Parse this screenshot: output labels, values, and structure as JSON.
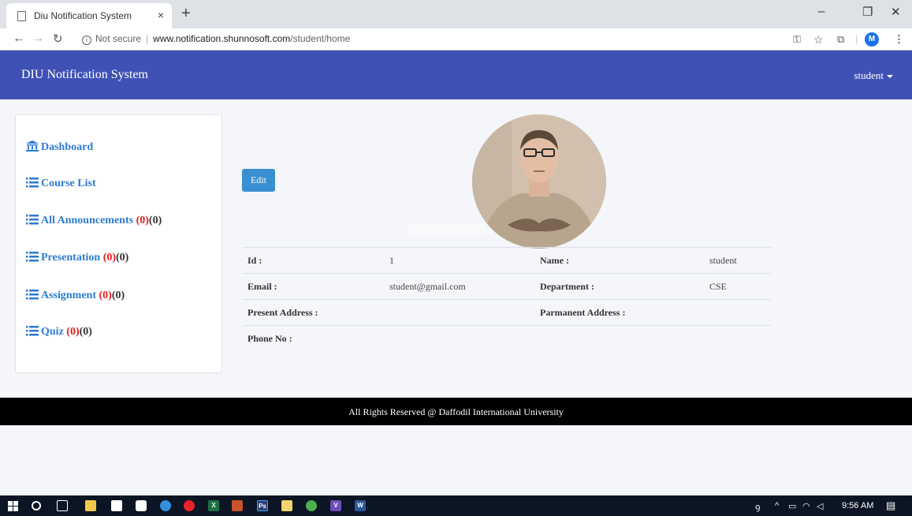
{
  "browser": {
    "tab_title": "Diu Notification System",
    "tab_close": "×",
    "new_tab": "+",
    "security_label": "Not secure",
    "url_host": "www.notification.shunnosoft.com",
    "url_path": "/student/home",
    "profile_initial": "M",
    "window_minimize": "–",
    "window_restore": "❐",
    "window_close": "✕"
  },
  "app": {
    "brand": "DIU Notification System",
    "user_menu": "student"
  },
  "sidebar": {
    "items": [
      {
        "label": "Dashboard",
        "icon": "bank-icon"
      },
      {
        "label": "Course List",
        "icon": "list-icon"
      },
      {
        "label": "All Announcements ",
        "count_new": "(0)",
        "count_total": "(0)",
        "icon": "list-icon"
      },
      {
        "label": "Presentation ",
        "count_new": "(0)",
        "count_total": "(0)",
        "icon": "list-icon"
      },
      {
        "label": "Assignment ",
        "count_new": "(0)",
        "count_total": "(0)",
        "icon": "list-icon"
      },
      {
        "label": "Quiz ",
        "count_new": "(0)",
        "count_total": "(0)",
        "icon": "list-icon"
      }
    ]
  },
  "profile": {
    "edit_label": "Edit",
    "rows": [
      {
        "l1": "Id :",
        "v1": "1",
        "l2": "Name :",
        "v2": "student"
      },
      {
        "l1": "Email :",
        "v1": "student@gmail.com",
        "l2": "Department :",
        "v2": "CSE"
      },
      {
        "l1": "Present Address :",
        "v1": "",
        "l2": "Parmanent Address :",
        "v2": ""
      },
      {
        "l1": "Phone No :",
        "v1": "",
        "l2": "",
        "v2": ""
      }
    ]
  },
  "footer": {
    "text": "All Rights Reserved @ Daffodil International University"
  },
  "taskbar": {
    "time": "9:56 AM"
  },
  "colors": {
    "appbar": "#3f51b5",
    "link": "#2d7bd0",
    "count_red": "#e31b1b",
    "edit_button": "#3a8fd0",
    "footer": "#000000"
  }
}
